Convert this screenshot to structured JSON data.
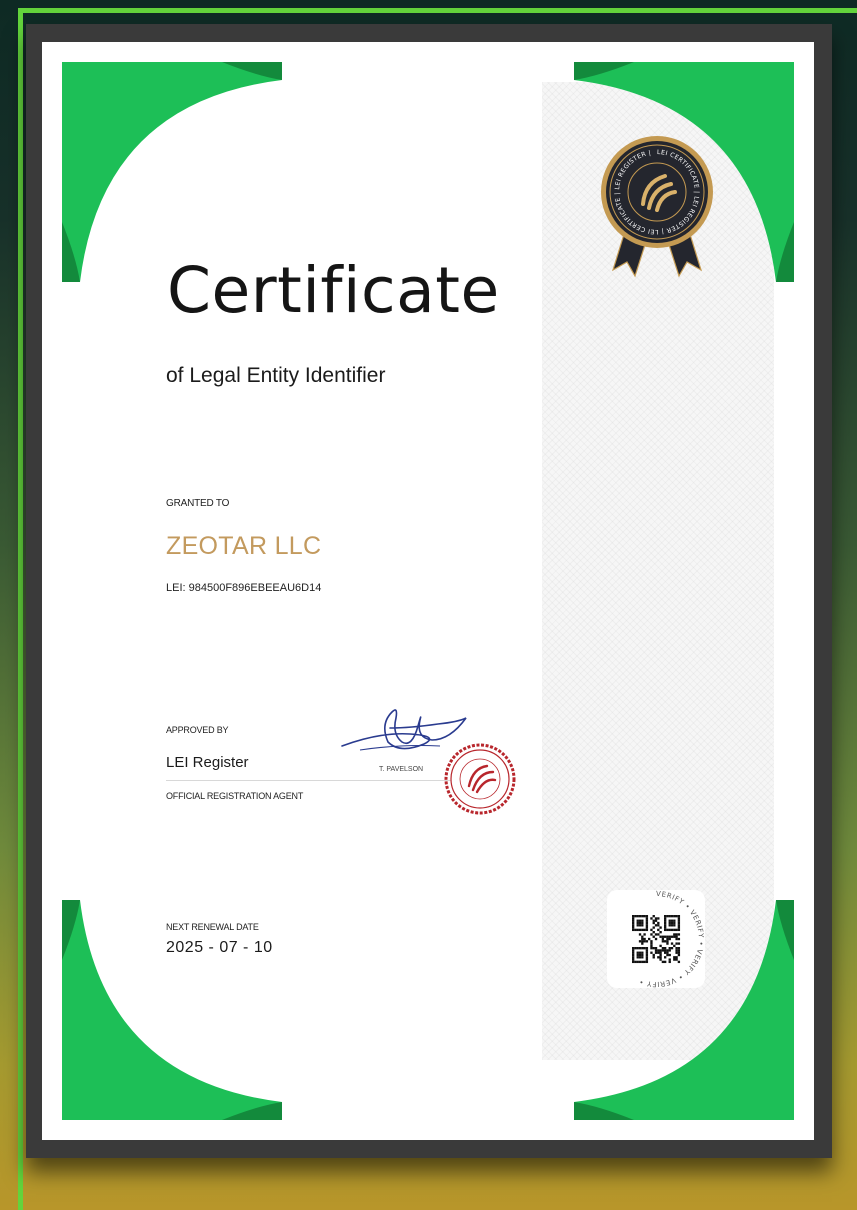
{
  "certificate": {
    "title": "Certificate",
    "subtitle": "of Legal Entity Identifier",
    "granted_to_label": "GRANTED TO",
    "entity_name": "ZEOTAR LLC",
    "lei": "LEI: 984500F896EBEEAU6D14",
    "approved_by_label": "APPROVED BY",
    "approver": "LEI Register",
    "agent_label": "OFFICIAL REGISTRATION AGENT",
    "signer": "T. PAVELSON",
    "renewal_label": "NEXT RENEWAL DATE",
    "renewal_date": "2025 - 07 - 10"
  },
  "seal": {
    "ring_text": "LEI CERTIFICATE  |  LEI REGISTER  |  LEI CERTIFICATE  |  LEI REGISTER  |",
    "icon": "globe-emblem-icon"
  },
  "qr": {
    "ring_text": "VERIFY • VERIFY • VERIFY • VERIFY •",
    "icon": "qr-code-icon"
  },
  "colors": {
    "accent_green": "#1dbf57",
    "gold": "#c39a5e",
    "seal_navy": "#24262e",
    "stamp_red": "#b8262c"
  }
}
